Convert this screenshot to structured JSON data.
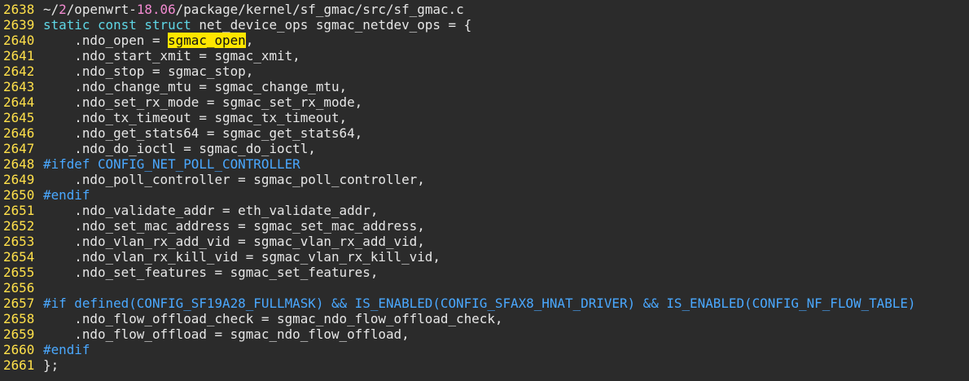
{
  "editor": {
    "lines": [
      {
        "n": "2638",
        "segments": [
          {
            "t": "~/",
            "c": "plain"
          },
          {
            "t": "2",
            "c": "num"
          },
          {
            "t": "/openwrt-",
            "c": "plain"
          },
          {
            "t": "18.06",
            "c": "num"
          },
          {
            "t": "/package/kernel/sf_gmac/src/sf_gmac.c",
            "c": "plain"
          }
        ]
      },
      {
        "n": "2639",
        "segments": [
          {
            "t": "static const struct",
            "c": "kw"
          },
          {
            "t": " net_device_ops sgmac_netdev_ops = {",
            "c": "plain"
          }
        ]
      },
      {
        "n": "2640",
        "segments": [
          {
            "t": "    .ndo_open = ",
            "c": "plain"
          },
          {
            "t": "sgmac_open",
            "c": "hl"
          },
          {
            "t": ",",
            "c": "plain"
          }
        ]
      },
      {
        "n": "2641",
        "segments": [
          {
            "t": "    .ndo_start_xmit = sgmac_xmit,",
            "c": "plain"
          }
        ]
      },
      {
        "n": "2642",
        "segments": [
          {
            "t": "    .ndo_stop = sgmac_stop,",
            "c": "plain"
          }
        ]
      },
      {
        "n": "2643",
        "segments": [
          {
            "t": "    .ndo_change_mtu = sgmac_change_mtu,",
            "c": "plain"
          }
        ]
      },
      {
        "n": "2644",
        "segments": [
          {
            "t": "    .ndo_set_rx_mode = sgmac_set_rx_mode,",
            "c": "plain"
          }
        ]
      },
      {
        "n": "2645",
        "segments": [
          {
            "t": "    .ndo_tx_timeout = sgmac_tx_timeout,",
            "c": "plain"
          }
        ]
      },
      {
        "n": "2646",
        "segments": [
          {
            "t": "    .ndo_get_stats64 = sgmac_get_stats64,",
            "c": "plain"
          }
        ]
      },
      {
        "n": "2647",
        "segments": [
          {
            "t": "    .ndo_do_ioctl = sgmac_do_ioctl,",
            "c": "plain"
          }
        ]
      },
      {
        "n": "2648",
        "segments": [
          {
            "t": "#ifdef CONFIG_NET_POLL_CONTROLLER",
            "c": "pp"
          }
        ]
      },
      {
        "n": "2649",
        "segments": [
          {
            "t": "    .ndo_poll_controller = sgmac_poll_controller,",
            "c": "plain"
          }
        ]
      },
      {
        "n": "2650",
        "segments": [
          {
            "t": "#endif",
            "c": "pp"
          }
        ]
      },
      {
        "n": "2651",
        "segments": [
          {
            "t": "    .ndo_validate_addr = eth_validate_addr,",
            "c": "plain"
          }
        ]
      },
      {
        "n": "2652",
        "segments": [
          {
            "t": "    .ndo_set_mac_address = sgmac_set_mac_address,",
            "c": "plain"
          }
        ]
      },
      {
        "n": "2653",
        "segments": [
          {
            "t": "    .ndo_vlan_rx_add_vid = sgmac_vlan_rx_add_vid,",
            "c": "plain"
          }
        ]
      },
      {
        "n": "2654",
        "segments": [
          {
            "t": "    .ndo_vlan_rx_kill_vid = sgmac_vlan_rx_kill_vid,",
            "c": "plain"
          }
        ]
      },
      {
        "n": "2655",
        "segments": [
          {
            "t": "    .ndo_set_features = sgmac_set_features,",
            "c": "plain"
          }
        ]
      },
      {
        "n": "2656",
        "segments": [
          {
            "t": "",
            "c": "plain"
          }
        ]
      },
      {
        "n": "2657",
        "segments": [
          {
            "t": "#if defined(CONFIG_SF19A28_FULLMASK) && IS_ENABLED(CONFIG_SFAX8_HNAT_DRIVER) && IS_ENABLED(CONFIG_NF_FLOW_TABLE)",
            "c": "pp"
          }
        ]
      },
      {
        "n": "2658",
        "segments": [
          {
            "t": "    .ndo_flow_offload_check = sgmac_ndo_flow_offload_check,",
            "c": "plain"
          }
        ]
      },
      {
        "n": "2659",
        "segments": [
          {
            "t": "    .ndo_flow_offload = sgmac_ndo_flow_offload,",
            "c": "plain"
          }
        ]
      },
      {
        "n": "2660",
        "segments": [
          {
            "t": "#endif",
            "c": "pp"
          }
        ]
      },
      {
        "n": "2661",
        "segments": [
          {
            "t": "};",
            "c": "plain"
          }
        ]
      }
    ]
  },
  "colors": {
    "background": "#2b2b2b",
    "line_number": "#ffe04a",
    "keyword": "#5fd7e6",
    "preprocessor": "#4aa8ff",
    "number": "#f38bd1",
    "search_highlight": "#ffe600"
  }
}
